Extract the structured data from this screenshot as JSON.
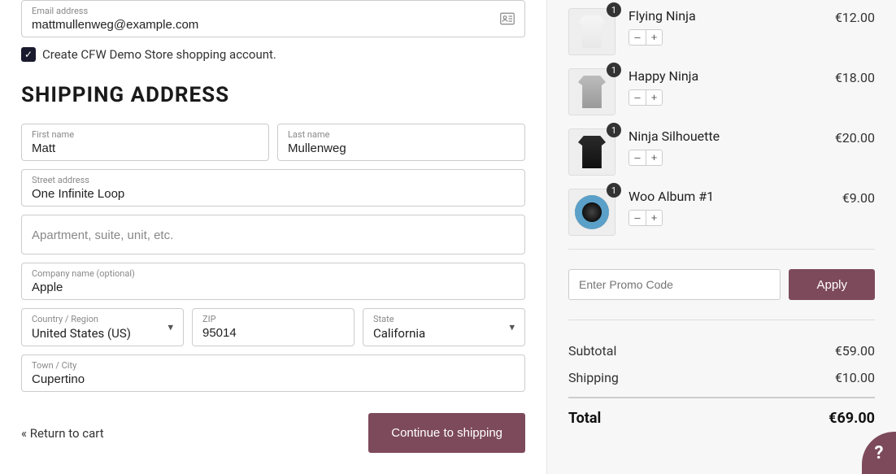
{
  "email": {
    "label": "Email address",
    "value": "mattmullenweg@example.com"
  },
  "create_account": {
    "checked": true,
    "label": "Create CFW Demo Store shopping account."
  },
  "shipping_heading": "SHIPPING ADDRESS",
  "first_name": {
    "label": "First name",
    "value": "Matt"
  },
  "last_name": {
    "label": "Last name",
    "value": "Mullenweg"
  },
  "street": {
    "label": "Street address",
    "value": "One Infinite Loop"
  },
  "apartment": {
    "placeholder": "Apartment, suite, unit, etc."
  },
  "company": {
    "label": "Company name (optional)",
    "value": "Apple"
  },
  "country": {
    "label": "Country / Region",
    "value": "United States (US)"
  },
  "zip": {
    "label": "ZIP",
    "value": "95014"
  },
  "state": {
    "label": "State",
    "value": "California"
  },
  "city": {
    "label": "Town / City",
    "value": "Cupertino"
  },
  "return_link": "« Return to cart",
  "continue_label": "Continue to shipping",
  "qty_minus": "–",
  "qty_plus": "+",
  "cart": [
    {
      "qty": 1,
      "title": "Flying Ninja",
      "price": "€12.00"
    },
    {
      "qty": 1,
      "title": "Happy Ninja",
      "price": "€18.00"
    },
    {
      "qty": 1,
      "title": "Ninja Silhouette",
      "price": "€20.00"
    },
    {
      "qty": 1,
      "title": "Woo Album #1",
      "price": "€9.00"
    }
  ],
  "promo": {
    "placeholder": "Enter Promo Code",
    "apply": "Apply"
  },
  "summary": {
    "subtotal_label": "Subtotal",
    "subtotal_value": "€59.00",
    "shipping_label": "Shipping",
    "shipping_value": "€10.00",
    "total_label": "Total",
    "total_value": "€69.00"
  },
  "help_icon": "?"
}
